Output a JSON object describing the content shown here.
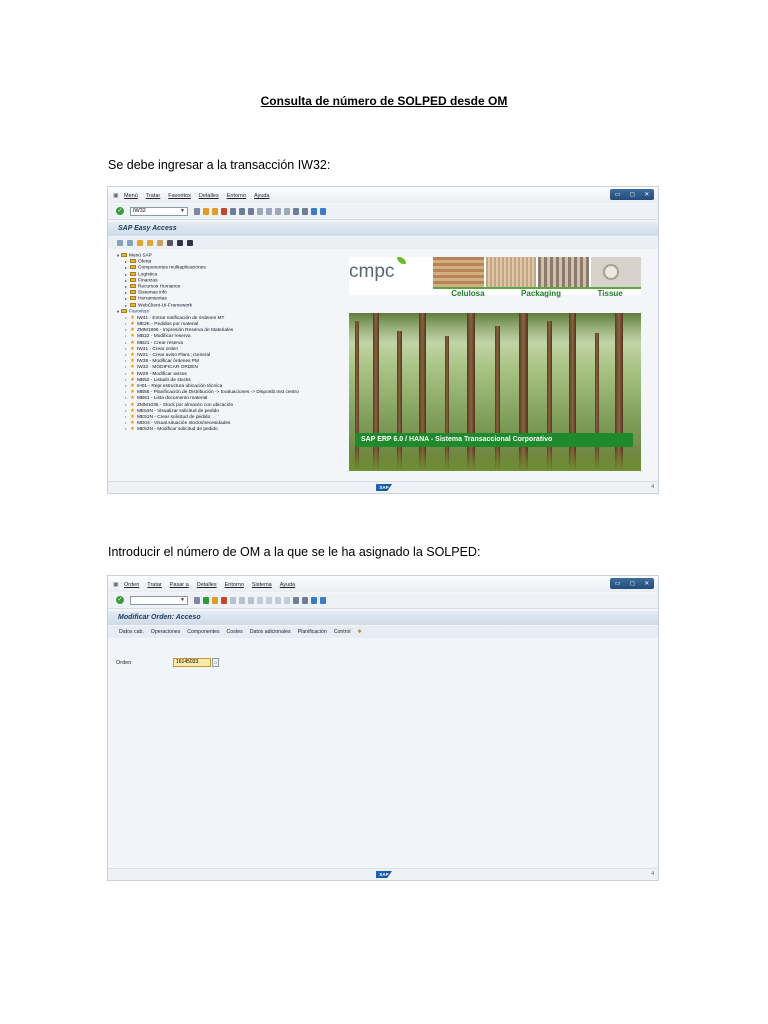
{
  "document": {
    "title": "Consulta de número de SOLPED desde OM",
    "instruction_1": "Se debe ingresar a la transacción IW32:",
    "instruction_2": "Introducir el número de OM a la que se le ha asignado la SOLPED:"
  },
  "screen1": {
    "menu": [
      "Menú",
      "Tratar",
      "Favoritos",
      "Detalles",
      "Entorno",
      "Ayuda"
    ],
    "command_value": "IW32",
    "title": "SAP Easy Access",
    "tree_root": "Menú SAP",
    "folders": [
      "Oferta",
      "Componentes multiaplicaciones",
      "Logística",
      "Finanzas",
      "Recursos Humanos",
      "Sistemas info",
      "Herramientas",
      "WebClient-UI-Framework"
    ],
    "favorites_label": "Favoritos",
    "favorites": [
      "IW41 - Entrar notificación de órdenes MT",
      "ME2K - Pedidos por material",
      "ZMM1896 - Impresión Reserva de Materiales",
      "MB22 - Modificar reserva",
      "MB21 - Crear reserva",
      "IW31 - Crear orden",
      "IW21 - Crear aviso Plant.; General",
      "IW38 - Modificar órdenes PM",
      "IW32 - MODIFICAR ORDEN",
      "IW29 - Modificar avisos",
      "MB52 - Listado de stocks",
      "IH01 - Repr.estructura ubicación técnica",
      "MB55 - Planificación de Distribución -> Evaluaciones -> Disponib.Inst centro",
      "MB51 - Lista documento material",
      "ZMM1035 - Stock por almacén con ubicación",
      "ME53N - Visualizar solicitud de pedido",
      "ME51N - Crear solicitud de pedido",
      "MD04 - Visual.situación stocks/necesidades",
      "ME52N - Modificar solicitud de pedido"
    ],
    "brand": "cmpc",
    "products": [
      "Celulosa",
      "Packaging",
      "Tissue"
    ],
    "banner": "SAP ERP 6.0 / HANA -  Sistema Transaccional Corporativo",
    "sap_logo": "SAP",
    "status_number": "4"
  },
  "screen2": {
    "menu": [
      "Orden",
      "Tratar",
      "Pasar a",
      "Detalles",
      "Entorno",
      "Sistema",
      "Ayuda"
    ],
    "title": "Modificar Orden: Acceso",
    "tabs": [
      "Datos cab.",
      "Operaciones",
      "Componentes",
      "Costes",
      "Datos adicionales",
      "Planificación",
      "Control"
    ],
    "order_label": "Orden",
    "order_value": "16145033",
    "sap_logo": "SAP",
    "status_number": "4"
  }
}
